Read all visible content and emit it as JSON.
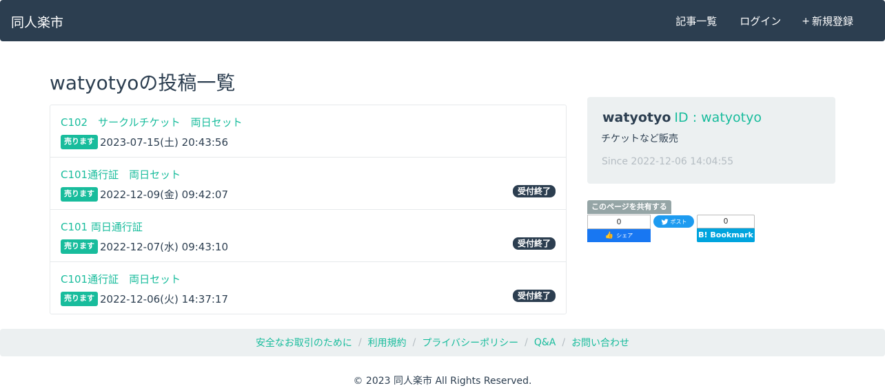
{
  "navbar": {
    "brand": "同人楽市",
    "links": [
      {
        "icon": "list-icon",
        "glyph": "",
        "label": "記事一覧"
      },
      {
        "icon": "login-icon",
        "glyph": "",
        "label": "ログイン"
      },
      {
        "icon": "plus-icon",
        "glyph": "+",
        "label": "新規登録"
      }
    ]
  },
  "page": {
    "title": "watyotyoの投稿一覧"
  },
  "posts": [
    {
      "title": "C102　サークルチケット　両日セット",
      "badge": "売ります",
      "date": "2023-07-15(土) 20:43:56",
      "status": ""
    },
    {
      "title": "C101通行証　両日セット",
      "badge": "売ります",
      "date": "2022-12-09(金) 09:42:07",
      "status": "受付終了"
    },
    {
      "title": "C101 両日通行証",
      "badge": "売ります",
      "date": "2022-12-07(水) 09:43:10",
      "status": "受付終了"
    },
    {
      "title": "C101通行証　両日セット",
      "badge": "売ります",
      "date": "2022-12-06(火) 14:37:17",
      "status": "受付終了"
    }
  ],
  "profile": {
    "user_glyph": "",
    "name": "watyotyo",
    "id_text": "ID : watyotyo",
    "bio": "チケットなど販売",
    "since_glyph": "",
    "since": "Since 2022-12-06 14:04:55"
  },
  "share": {
    "label": "このページを共有する",
    "facebook": {
      "count": "0",
      "button_label": "シェア"
    },
    "twitter": {
      "button_label": "ポスト"
    },
    "hatena": {
      "count": "0",
      "button_label": "B! Bookmark"
    }
  },
  "footer": {
    "links": [
      "安全なお取引のために",
      "利用規約",
      "プライバシーポリシー",
      "Q&A",
      "お問い合わせ"
    ],
    "separator": "/",
    "copyright": "© 2023 同人楽市 All Rights Reserved."
  },
  "colors": {
    "navbar": "#2c3e50",
    "accent": "#18bc9c",
    "light_bg": "#ecf0f1",
    "muted": "#b4bcc2",
    "facebook": "#1877f2",
    "twitter": "#1d9bf0",
    "hatena": "#00a4de"
  }
}
